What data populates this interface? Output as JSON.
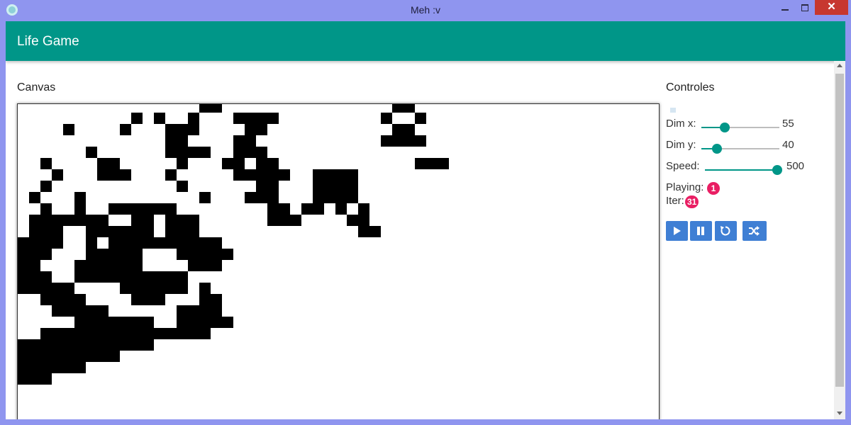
{
  "window": {
    "title": "Meh :v",
    "close_glyph": "✕"
  },
  "app": {
    "title": "Life Game"
  },
  "canvas": {
    "heading": "Canvas"
  },
  "controls": {
    "heading": "Controles",
    "dim_x": {
      "label": "Dim x:",
      "value": "55",
      "fraction": 0.3
    },
    "dim_y": {
      "label": "Dim y:",
      "value": "40",
      "fraction": 0.2
    },
    "speed": {
      "label": "Speed:",
      "value": "500",
      "fraction": 1.0
    },
    "playing": {
      "label": "Playing:",
      "value": "1"
    },
    "iter": {
      "label": "Iter:",
      "value": "31"
    },
    "buttons": [
      {
        "name": "play-button",
        "icon": "play-icon"
      },
      {
        "name": "pause-button",
        "icon": "pause-icon"
      },
      {
        "name": "reset-button",
        "icon": "refresh-icon"
      },
      {
        "name": "random-button",
        "icon": "shuffle-icon"
      }
    ]
  },
  "colors": {
    "appbar": "#009688",
    "accent": "#009688",
    "badge": "#e91e63",
    "button": "#3f7fd4",
    "titlebar": "#8f95ef",
    "cell": "#000000"
  },
  "grid": {
    "cell_size": 16,
    "alive": [
      [
        16,
        0
      ],
      [
        17,
        0
      ],
      [
        33,
        0
      ],
      [
        34,
        0
      ],
      [
        10,
        1
      ],
      [
        12,
        1
      ],
      [
        15,
        1
      ],
      [
        19,
        1
      ],
      [
        20,
        1
      ],
      [
        21,
        1
      ],
      [
        22,
        1
      ],
      [
        32,
        1
      ],
      [
        35,
        1
      ],
      [
        4,
        2
      ],
      [
        9,
        2
      ],
      [
        13,
        2
      ],
      [
        14,
        2
      ],
      [
        15,
        2
      ],
      [
        20,
        2
      ],
      [
        21,
        2
      ],
      [
        33,
        2
      ],
      [
        34,
        2
      ],
      [
        13,
        3
      ],
      [
        14,
        3
      ],
      [
        19,
        3
      ],
      [
        20,
        3
      ],
      [
        32,
        3
      ],
      [
        33,
        3
      ],
      [
        34,
        3
      ],
      [
        35,
        3
      ],
      [
        6,
        4
      ],
      [
        13,
        4
      ],
      [
        14,
        4
      ],
      [
        15,
        4
      ],
      [
        16,
        4
      ],
      [
        19,
        4
      ],
      [
        20,
        4
      ],
      [
        21,
        4
      ],
      [
        2,
        5
      ],
      [
        7,
        5
      ],
      [
        8,
        5
      ],
      [
        14,
        5
      ],
      [
        18,
        5
      ],
      [
        19,
        5
      ],
      [
        21,
        5
      ],
      [
        22,
        5
      ],
      [
        35,
        5
      ],
      [
        36,
        5
      ],
      [
        37,
        5
      ],
      [
        3,
        6
      ],
      [
        7,
        6
      ],
      [
        8,
        6
      ],
      [
        9,
        6
      ],
      [
        13,
        6
      ],
      [
        19,
        6
      ],
      [
        20,
        6
      ],
      [
        21,
        6
      ],
      [
        22,
        6
      ],
      [
        23,
        6
      ],
      [
        26,
        6
      ],
      [
        27,
        6
      ],
      [
        28,
        6
      ],
      [
        29,
        6
      ],
      [
        2,
        7
      ],
      [
        14,
        7
      ],
      [
        21,
        7
      ],
      [
        22,
        7
      ],
      [
        26,
        7
      ],
      [
        27,
        7
      ],
      [
        28,
        7
      ],
      [
        29,
        7
      ],
      [
        1,
        8
      ],
      [
        5,
        8
      ],
      [
        16,
        8
      ],
      [
        20,
        8
      ],
      [
        21,
        8
      ],
      [
        22,
        8
      ],
      [
        26,
        8
      ],
      [
        27,
        8
      ],
      [
        28,
        8
      ],
      [
        29,
        8
      ],
      [
        2,
        9
      ],
      [
        5,
        9
      ],
      [
        8,
        9
      ],
      [
        9,
        9
      ],
      [
        10,
        9
      ],
      [
        11,
        9
      ],
      [
        12,
        9
      ],
      [
        13,
        9
      ],
      [
        22,
        9
      ],
      [
        23,
        9
      ],
      [
        25,
        9
      ],
      [
        26,
        9
      ],
      [
        28,
        9
      ],
      [
        30,
        9
      ],
      [
        1,
        10
      ],
      [
        2,
        10
      ],
      [
        3,
        10
      ],
      [
        4,
        10
      ],
      [
        5,
        10
      ],
      [
        6,
        10
      ],
      [
        7,
        10
      ],
      [
        10,
        10
      ],
      [
        11,
        10
      ],
      [
        13,
        10
      ],
      [
        14,
        10
      ],
      [
        15,
        10
      ],
      [
        22,
        10
      ],
      [
        23,
        10
      ],
      [
        24,
        10
      ],
      [
        29,
        10
      ],
      [
        30,
        10
      ],
      [
        1,
        11
      ],
      [
        2,
        11
      ],
      [
        3,
        11
      ],
      [
        6,
        11
      ],
      [
        7,
        11
      ],
      [
        8,
        11
      ],
      [
        9,
        11
      ],
      [
        10,
        11
      ],
      [
        11,
        11
      ],
      [
        13,
        11
      ],
      [
        14,
        11
      ],
      [
        15,
        11
      ],
      [
        30,
        11
      ],
      [
        31,
        11
      ],
      [
        0,
        12
      ],
      [
        1,
        12
      ],
      [
        2,
        12
      ],
      [
        3,
        12
      ],
      [
        6,
        12
      ],
      [
        8,
        12
      ],
      [
        9,
        12
      ],
      [
        10,
        12
      ],
      [
        11,
        12
      ],
      [
        12,
        12
      ],
      [
        13,
        12
      ],
      [
        14,
        12
      ],
      [
        15,
        12
      ],
      [
        16,
        12
      ],
      [
        17,
        12
      ],
      [
        0,
        13
      ],
      [
        1,
        13
      ],
      [
        2,
        13
      ],
      [
        6,
        13
      ],
      [
        7,
        13
      ],
      [
        8,
        13
      ],
      [
        9,
        13
      ],
      [
        10,
        13
      ],
      [
        14,
        13
      ],
      [
        15,
        13
      ],
      [
        16,
        13
      ],
      [
        17,
        13
      ],
      [
        18,
        13
      ],
      [
        0,
        14
      ],
      [
        1,
        14
      ],
      [
        5,
        14
      ],
      [
        6,
        14
      ],
      [
        7,
        14
      ],
      [
        8,
        14
      ],
      [
        9,
        14
      ],
      [
        10,
        14
      ],
      [
        15,
        14
      ],
      [
        16,
        14
      ],
      [
        17,
        14
      ],
      [
        0,
        15
      ],
      [
        1,
        15
      ],
      [
        2,
        15
      ],
      [
        5,
        15
      ],
      [
        6,
        15
      ],
      [
        7,
        15
      ],
      [
        8,
        15
      ],
      [
        9,
        15
      ],
      [
        10,
        15
      ],
      [
        11,
        15
      ],
      [
        12,
        15
      ],
      [
        13,
        15
      ],
      [
        14,
        15
      ],
      [
        0,
        16
      ],
      [
        1,
        16
      ],
      [
        2,
        16
      ],
      [
        3,
        16
      ],
      [
        4,
        16
      ],
      [
        9,
        16
      ],
      [
        10,
        16
      ],
      [
        11,
        16
      ],
      [
        12,
        16
      ],
      [
        13,
        16
      ],
      [
        14,
        16
      ],
      [
        16,
        16
      ],
      [
        2,
        17
      ],
      [
        3,
        17
      ],
      [
        4,
        17
      ],
      [
        5,
        17
      ],
      [
        10,
        17
      ],
      [
        11,
        17
      ],
      [
        12,
        17
      ],
      [
        16,
        17
      ],
      [
        17,
        17
      ],
      [
        3,
        18
      ],
      [
        4,
        18
      ],
      [
        5,
        18
      ],
      [
        6,
        18
      ],
      [
        7,
        18
      ],
      [
        14,
        18
      ],
      [
        15,
        18
      ],
      [
        16,
        18
      ],
      [
        17,
        18
      ],
      [
        5,
        19
      ],
      [
        6,
        19
      ],
      [
        7,
        19
      ],
      [
        8,
        19
      ],
      [
        9,
        19
      ],
      [
        10,
        19
      ],
      [
        11,
        19
      ],
      [
        14,
        19
      ],
      [
        15,
        19
      ],
      [
        16,
        19
      ],
      [
        17,
        19
      ],
      [
        18,
        19
      ],
      [
        2,
        20
      ],
      [
        3,
        20
      ],
      [
        4,
        20
      ],
      [
        5,
        20
      ],
      [
        6,
        20
      ],
      [
        7,
        20
      ],
      [
        8,
        20
      ],
      [
        9,
        20
      ],
      [
        10,
        20
      ],
      [
        11,
        20
      ],
      [
        12,
        20
      ],
      [
        13,
        20
      ],
      [
        14,
        20
      ],
      [
        15,
        20
      ],
      [
        16,
        20
      ],
      [
        0,
        21
      ],
      [
        1,
        21
      ],
      [
        2,
        21
      ],
      [
        3,
        21
      ],
      [
        4,
        21
      ],
      [
        5,
        21
      ],
      [
        6,
        21
      ],
      [
        7,
        21
      ],
      [
        8,
        21
      ],
      [
        9,
        21
      ],
      [
        10,
        21
      ],
      [
        11,
        21
      ],
      [
        0,
        22
      ],
      [
        1,
        22
      ],
      [
        2,
        22
      ],
      [
        3,
        22
      ],
      [
        4,
        22
      ],
      [
        5,
        22
      ],
      [
        6,
        22
      ],
      [
        7,
        22
      ],
      [
        8,
        22
      ],
      [
        0,
        23
      ],
      [
        1,
        23
      ],
      [
        2,
        23
      ],
      [
        3,
        23
      ],
      [
        4,
        23
      ],
      [
        5,
        23
      ],
      [
        0,
        24
      ],
      [
        1,
        24
      ],
      [
        2,
        24
      ]
    ]
  }
}
